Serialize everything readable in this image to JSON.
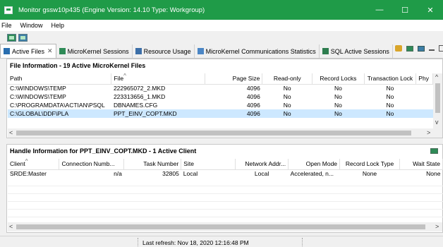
{
  "window": {
    "title": "Monitor gssw10p435  (Engine Version: 14.10  Type: Workgroup)",
    "minimize": "—",
    "maximize": "☐",
    "close": "✕"
  },
  "menu": [
    "File",
    "Window",
    "Help"
  ],
  "tabs": [
    {
      "label": "Active Files",
      "close": "✕"
    },
    {
      "label": "MicroKernel Sessions"
    },
    {
      "label": "Resource Usage"
    },
    {
      "label": "MicroKernel Communications Statistics"
    },
    {
      "label": "SQL Active Sessions"
    }
  ],
  "file_panel": {
    "title": "File Information - 19 Active MicroKernel Files",
    "columns": [
      "Path",
      "File",
      "Page Size",
      "Read-only",
      "Record Locks",
      "Transaction Lock",
      "Phy"
    ],
    "rows": [
      [
        "C:\\WINDOWS\\TEMP",
        "222965072_2.MKD",
        "4096",
        "No",
        "No",
        "No",
        ""
      ],
      [
        "C:\\WINDOWS\\TEMP",
        "223313656_1.MKD",
        "4096",
        "No",
        "No",
        "No",
        ""
      ],
      [
        "C:\\PROGRAMDATA\\ACTIAN\\PSQL",
        "DBNAMES.CFG",
        "4096",
        "No",
        "No",
        "No",
        ""
      ],
      [
        "C:\\GLOBAL\\DDF\\PLA",
        "PPT_EINV_COPT.MKD",
        "4096",
        "No",
        "No",
        "No",
        ""
      ]
    ],
    "selected_row": 3
  },
  "handle_panel": {
    "title": "Handle Information for PPT_EINV_COPT.MKD - 1 Active Client",
    "columns": [
      "Client",
      "Connection Numb...",
      "Task Number",
      "Site",
      "Network Addr...",
      "Open Mode",
      "Record Lock Type",
      "Wait State"
    ],
    "rows": [
      [
        "SRDE:Master",
        "n/a",
        "32805",
        "Local",
        "Local",
        "Accelerated, n...",
        "None",
        "None"
      ]
    ]
  },
  "status": {
    "text": "Last refresh: Nov 18, 2020 12:16:48 PM"
  },
  "colors": {
    "titlebar": "#1f9b48",
    "selection": "#cde8ff"
  }
}
